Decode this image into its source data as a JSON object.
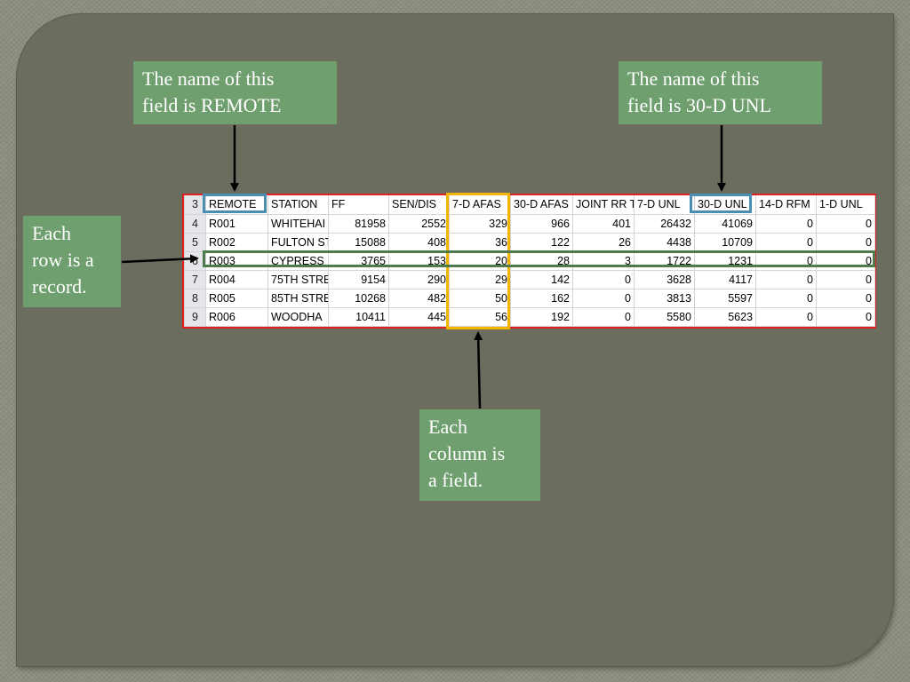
{
  "callouts": {
    "remote_field": "The name of this\nfield is REMOTE",
    "unl30_field": "The name of this\nfield is 30-D UNL",
    "row_record": "Each\nrow is a\nrecord.",
    "column_field": "Each\ncolumn is\na field."
  },
  "spreadsheet": {
    "header": {
      "row_number": "3",
      "cells": [
        "REMOTE",
        "STATION",
        "FF",
        "SEN/DIS",
        "7-D AFAS",
        "30-D AFAS",
        "JOINT RR T",
        "7-D UNL",
        "30-D UNL",
        "14-D RFM",
        "1-D UNL"
      ]
    },
    "rows": [
      {
        "row_number": "4",
        "cells": [
          "R001",
          "WHITEHAI",
          "81958",
          "2552",
          "329",
          "966",
          "401",
          "26432",
          "41069",
          "0",
          "0"
        ]
      },
      {
        "row_number": "5",
        "cells": [
          "R002",
          "FULTON ST",
          "15088",
          "408",
          "36",
          "122",
          "26",
          "4438",
          "10709",
          "0",
          "0"
        ]
      },
      {
        "row_number": "6",
        "cells": [
          "R003",
          "CYPRESS H",
          "3765",
          "153",
          "20",
          "28",
          "3",
          "1722",
          "1231",
          "0",
          "0"
        ]
      },
      {
        "row_number": "7",
        "cells": [
          "R004",
          "75TH STRE",
          "9154",
          "290",
          "29",
          "142",
          "0",
          "3628",
          "4117",
          "0",
          "0"
        ]
      },
      {
        "row_number": "8",
        "cells": [
          "R005",
          "85TH STRE",
          "10268",
          "482",
          "50",
          "162",
          "0",
          "3813",
          "5597",
          "0",
          "0"
        ]
      },
      {
        "row_number": "9",
        "cells": [
          "R006",
          "WOODHA",
          "10411",
          "445",
          "56",
          "192",
          "0",
          "5580",
          "5623",
          "0",
          "0"
        ]
      }
    ]
  },
  "colors": {
    "callout_bg": "#6f9f6f",
    "slide_bg": "#6b6d5f",
    "field_name_highlight": "#4a8fb0",
    "column_highlight": "#f5b400",
    "row_highlight": "#4e7a4e",
    "table_border": "#e02020"
  }
}
